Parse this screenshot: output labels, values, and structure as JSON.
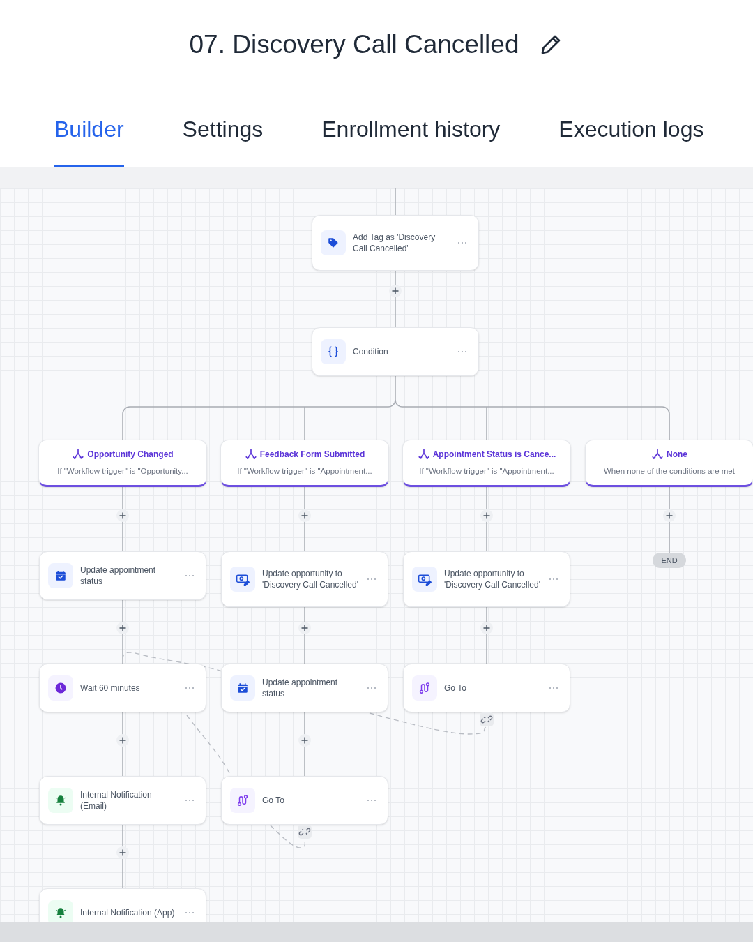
{
  "title": "07. Discovery Call Cancelled",
  "tabs": [
    {
      "label": "Builder",
      "selected": true
    },
    {
      "label": "Settings",
      "selected": false
    },
    {
      "label": "Enrollment history",
      "selected": false
    },
    {
      "label": "Execution logs",
      "selected": false
    }
  ],
  "steps": [
    {
      "kind": "tag",
      "label": "Add Tag as 'Discovery Call Cancelled'"
    },
    {
      "kind": "condition",
      "label": "Condition"
    }
  ],
  "branches": [
    {
      "title": "Opportunity Changed",
      "subtitle": "If \"Workflow trigger\" is \"Opportunity...",
      "steps": [
        {
          "kind": "calendar",
          "label": "Update appointment status"
        },
        {
          "kind": "wait",
          "label": "Wait 60 minutes"
        },
        {
          "kind": "notification",
          "label": "Internal Notification (Email)"
        },
        {
          "kind": "notification",
          "label": "Internal Notification (App)"
        }
      ]
    },
    {
      "title": "Feedback Form Submitted",
      "subtitle": "If \"Workflow trigger\" is \"Appointment...",
      "steps": [
        {
          "kind": "opportunity",
          "label": "Update opportunity to 'Discovery Call Cancelled'"
        },
        {
          "kind": "calendar",
          "label": "Update appointment status"
        },
        {
          "kind": "goto",
          "label": "Go To"
        }
      ]
    },
    {
      "title": "Appointment Status is Cance...",
      "subtitle": "If \"Workflow trigger\" is \"Appointment...",
      "steps": [
        {
          "kind": "opportunity",
          "label": "Update opportunity to 'Discovery Call Cancelled'"
        },
        {
          "kind": "goto",
          "label": "Go To"
        }
      ]
    },
    {
      "title": "None",
      "subtitle": "When none of the conditions are met",
      "end": "END"
    }
  ]
}
